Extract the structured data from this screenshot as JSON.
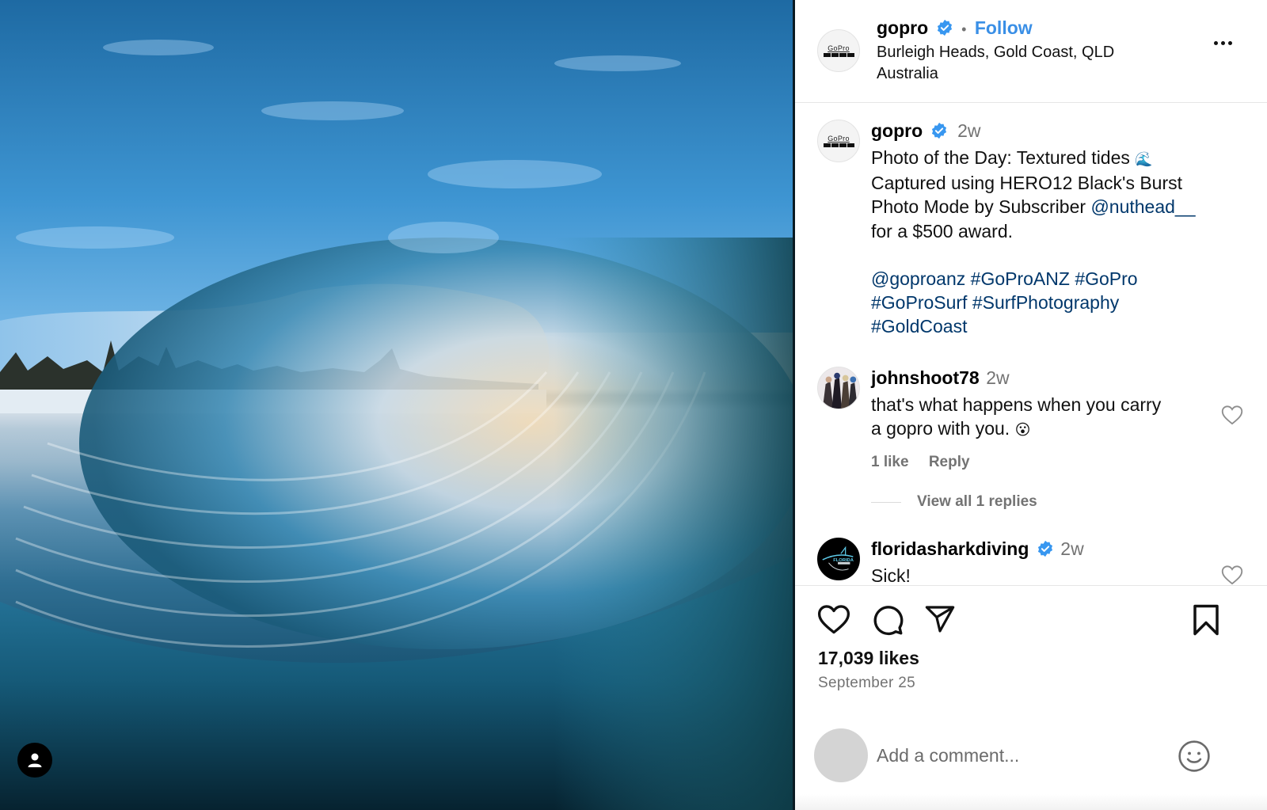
{
  "post": {
    "author": "gopro",
    "verified": true,
    "follow_label": "Follow",
    "separator": "•",
    "location_line1": "Burleigh Heads, Gold Coast, QLD",
    "location_line2": "Australia",
    "more_icon": "more-horizontal-icon",
    "image_alt": "Underwater view through a barreling wave toward a tree-lined beach at sunset",
    "profile_badge_icon": "user-icon"
  },
  "caption": {
    "author": "gopro",
    "time": "2w",
    "line1": "Photo of the Day: Textured tides",
    "line1_emoji": "🌊",
    "line2": "Captured using HERO12 Black's Burst",
    "line3_prefix": "Photo Mode by Subscriber ",
    "line3_mention": "@nuthead__",
    "line4": "for a $500 award.",
    "tags": [
      "@goproanz",
      "#GoProANZ",
      "#GoPro",
      "#GoProSurf",
      "#SurfPhotography",
      "#GoldCoast"
    ]
  },
  "comments": [
    {
      "author": "johnshoot78",
      "verified": false,
      "time": "2w",
      "line1": "that's what happens when you carry",
      "line2": "a gopro with you.",
      "emoji": "😮",
      "likes_label": "1 like",
      "reply_label": "Reply",
      "view_replies_label": "View all 1 replies"
    },
    {
      "author": "floridasharkdiving",
      "verified": true,
      "time": "2w",
      "text": "Sick!",
      "avatar_text": "FLORIDA"
    }
  ],
  "actions": {
    "like_icon": "heart-icon",
    "comment_icon": "comment-icon",
    "share_icon": "send-icon",
    "save_icon": "bookmark-icon"
  },
  "stats": {
    "likes": "17,039 likes",
    "date": "September 25"
  },
  "comment_input": {
    "placeholder": "Add a comment...",
    "value": "",
    "emoji_icon": "smiley-icon"
  },
  "colors": {
    "accent": "#3a8fe6",
    "link": "#00376b",
    "muted": "#737373",
    "verified": "#3897f0"
  }
}
